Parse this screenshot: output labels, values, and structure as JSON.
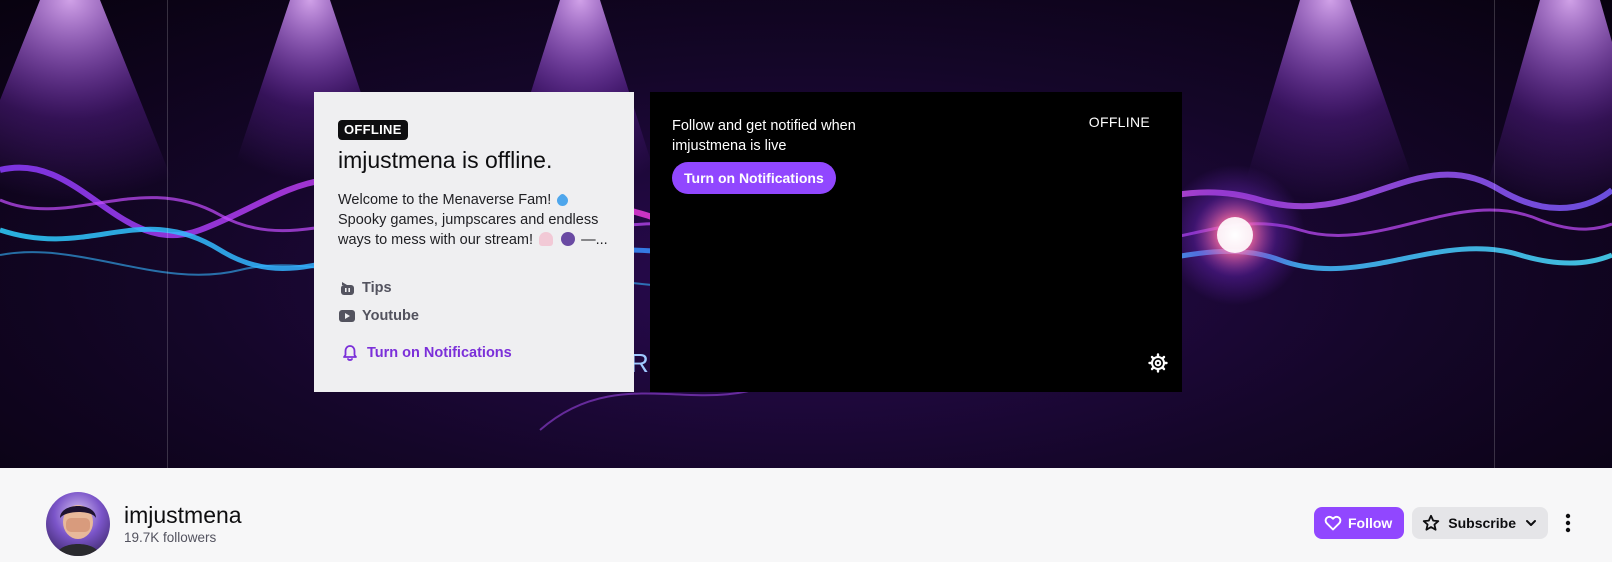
{
  "info_card": {
    "badge": "OFFLINE",
    "title": "imjustmena is offline.",
    "description_line1": "Welcome to the Menaverse Fam!",
    "description_line2": "Spooky games, jumpscares and endless",
    "description_line3": "ways to mess with our stream!",
    "description_tail": "—...",
    "links": [
      {
        "label": "Tips",
        "icon": "streamelements-icon"
      },
      {
        "label": "Youtube",
        "icon": "youtube-icon"
      }
    ],
    "notifications_label": "Turn on Notifications"
  },
  "player": {
    "prompt": "Follow and get notified when imjustmena is live",
    "notifications_button": "Turn on Notifications",
    "status_label": "OFFLINE"
  },
  "banner": {
    "partial_text": "RI"
  },
  "channel": {
    "name": "imjustmena",
    "followers": "19.7K followers",
    "follow_label": "Follow",
    "subscribe_label": "Subscribe"
  },
  "colors": {
    "accent": "#9147ff",
    "accent_text": "#7b2fd9",
    "card_bg": "#efeff1",
    "player_bg": "#000000",
    "bar_bg": "#f7f7f8"
  }
}
